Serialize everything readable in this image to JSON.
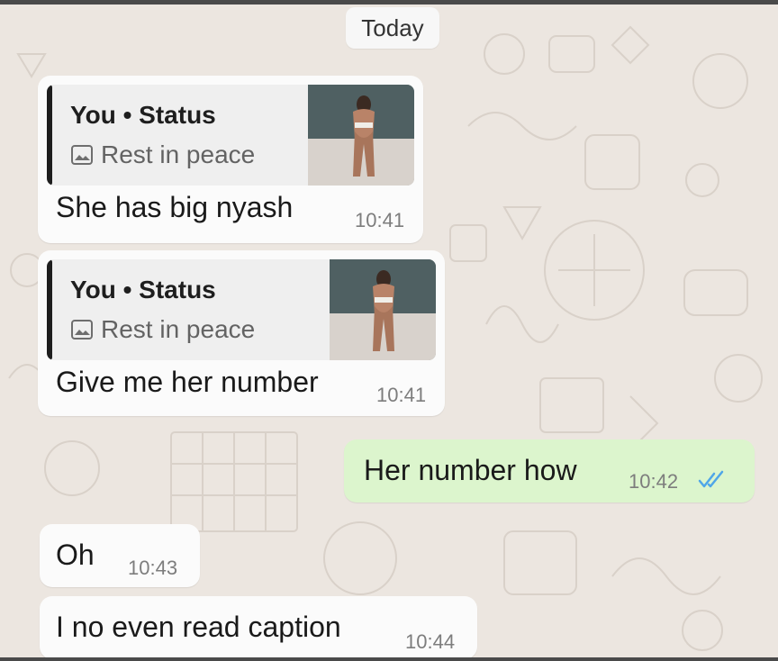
{
  "chat": {
    "date_label": "Today",
    "messages": [
      {
        "direction": "in",
        "reply": {
          "author": "You • Status",
          "caption": "Rest in peace",
          "icon": "image-icon"
        },
        "text": "She has  big nyash",
        "time": "10:41"
      },
      {
        "direction": "in",
        "reply": {
          "author": "You • Status",
          "caption": "Rest in peace",
          "icon": "image-icon"
        },
        "text": "Give me her number",
        "time": "10:41"
      },
      {
        "direction": "out",
        "text": "Her number  how",
        "time": "10:42",
        "status_icon": "double-check-read-icon"
      },
      {
        "direction": "in",
        "text": "Oh",
        "time": "10:43"
      },
      {
        "direction": "in",
        "text": "I no even read caption",
        "time": "10:44"
      }
    ]
  },
  "colors": {
    "wallpaper": "#ece6e0",
    "incoming_bubble": "#fbfbfb",
    "outgoing_bubble": "#dcf5cd",
    "quote_background": "#efefef",
    "quote_bar": "#1e1e1e",
    "read_ticks": "#4fa6e8"
  }
}
